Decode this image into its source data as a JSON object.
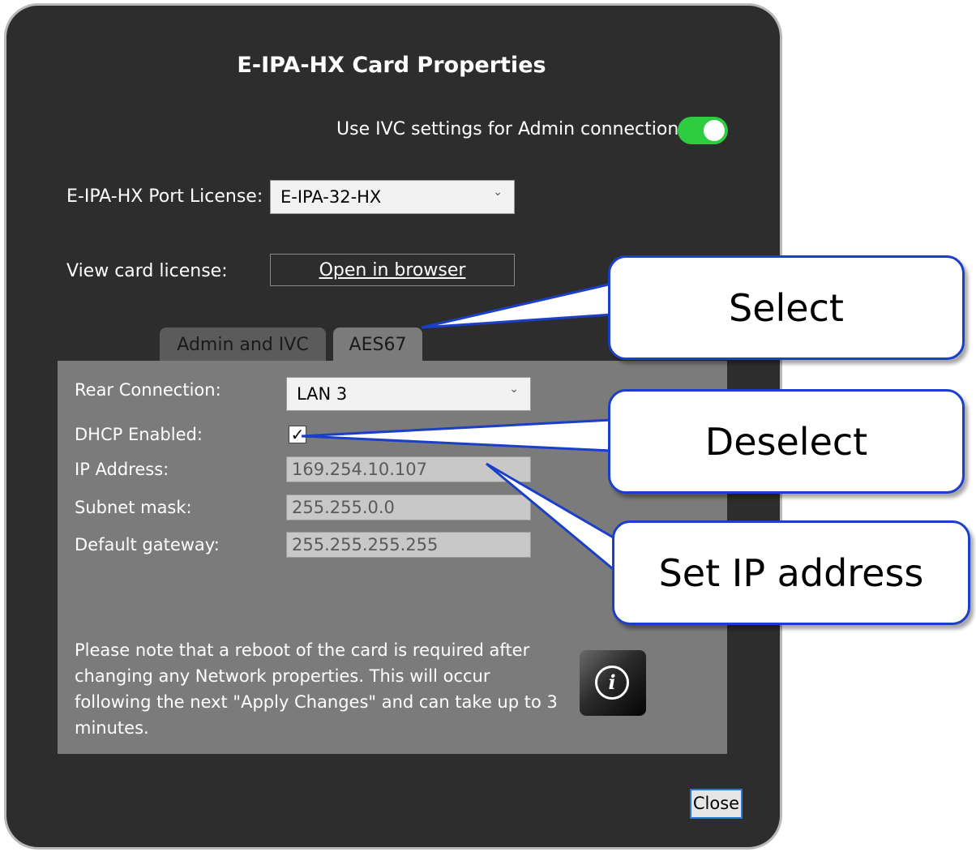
{
  "dialog": {
    "title": "E-IPA-HX Card Properties",
    "ivc_toggle_label": "Use IVC settings for Admin connection",
    "ivc_toggle_on": true,
    "port_license_label": "E-IPA-HX Port License:",
    "port_license_value": "E-IPA-32-HX",
    "view_license_label": "View card license:",
    "open_browser_label": "Open in browser",
    "tabs": [
      {
        "label": "Admin and IVC",
        "active": false
      },
      {
        "label": "AES67",
        "active": true
      }
    ],
    "panel": {
      "rear_connection_label": "Rear Connection:",
      "rear_connection_value": "LAN 3",
      "dhcp_label": "DHCP Enabled:",
      "dhcp_checked": true,
      "ip_label": "IP Address:",
      "ip_value": "169.254.10.107",
      "subnet_label": "Subnet mask:",
      "subnet_value": "255.255.0.0",
      "gateway_label": "Default gateway:",
      "gateway_value": "255.255.255.255",
      "note": "Please note that a reboot of the card is required after changing any Network properties. This will occur following the next \"Apply Changes\" and can take up to 3 minutes."
    },
    "close_label": "Close"
  },
  "callouts": {
    "select": "Select",
    "deselect": "Deselect",
    "set_ip": "Set IP address"
  },
  "colors": {
    "dialog_bg": "#2d2d2d",
    "panel_bg": "#7b7b7b",
    "toggle_on": "#2ecc40",
    "callout_border": "#1b3fc9"
  }
}
